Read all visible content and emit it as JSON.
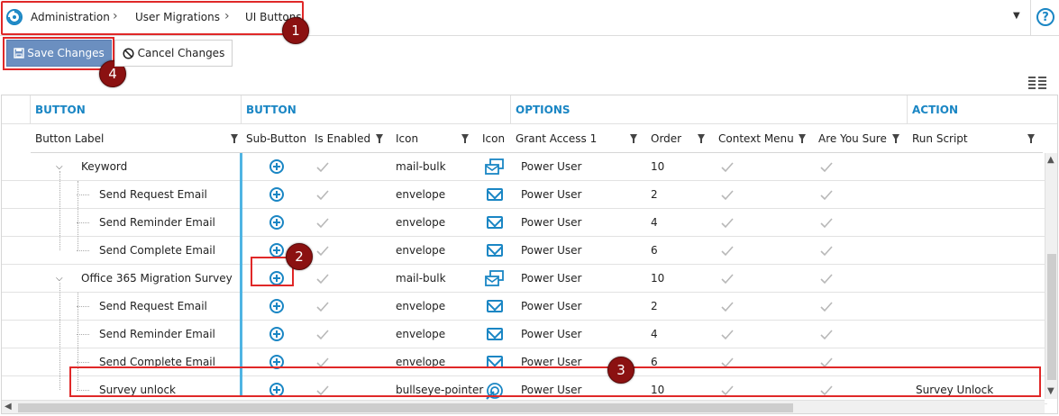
{
  "breadcrumbs": [
    "Administration",
    "User Migrations",
    "UI Buttons"
  ],
  "toolbar": {
    "save_label": "Save Changes",
    "cancel_label": "Cancel Changes"
  },
  "badges": [
    "1",
    "2",
    "3",
    "4"
  ],
  "group_headers": [
    "BUTTON",
    "BUTTON",
    "OPTIONS",
    "ACTION"
  ],
  "columns": [
    "Button Label",
    "Sub-Button",
    "Is Enabled",
    "Icon",
    "Icon",
    "Grant Access 1",
    "Order",
    "Context Menu",
    "Are You Sure",
    "Run Script"
  ],
  "rows": [
    {
      "label": "Keyword",
      "level": 1,
      "expandable": true,
      "icon": "mail-bulk",
      "icon_type": "bulk",
      "grant": "Power User",
      "order": "10",
      "script": ""
    },
    {
      "label": "Send Request Email",
      "level": 2,
      "icon": "envelope",
      "icon_type": "env",
      "grant": "Power User",
      "order": "2",
      "script": ""
    },
    {
      "label": "Send Reminder Email",
      "level": 2,
      "icon": "envelope",
      "icon_type": "env",
      "grant": "Power User",
      "order": "4",
      "script": ""
    },
    {
      "label": "Send Complete Email",
      "level": 2,
      "icon": "envelope",
      "icon_type": "env",
      "grant": "Power User",
      "order": "6",
      "script": ""
    },
    {
      "label": "Office 365 Migration Survey",
      "level": 1,
      "expandable": true,
      "icon": "mail-bulk",
      "icon_type": "bulk",
      "grant": "Power User",
      "order": "10",
      "script": ""
    },
    {
      "label": "Send Request Email",
      "level": 2,
      "icon": "envelope",
      "icon_type": "env",
      "grant": "Power User",
      "order": "2",
      "script": ""
    },
    {
      "label": "Send Reminder Email",
      "level": 2,
      "icon": "envelope",
      "icon_type": "env",
      "grant": "Power User",
      "order": "4",
      "script": ""
    },
    {
      "label": "Send Complete Email",
      "level": 2,
      "icon": "envelope",
      "icon_type": "env",
      "grant": "Power User",
      "order": "6",
      "script": ""
    },
    {
      "label": "Survey unlock",
      "level": 2,
      "icon": "bullseye-pointer",
      "icon_type": "bull",
      "grant": "Power User",
      "order": "10",
      "script": "Survey Unlock"
    }
  ],
  "colors": {
    "accent": "#1a86c4",
    "save_bg": "#6b8fc0",
    "highlight": "#e02828",
    "badge": "#8b1111"
  }
}
